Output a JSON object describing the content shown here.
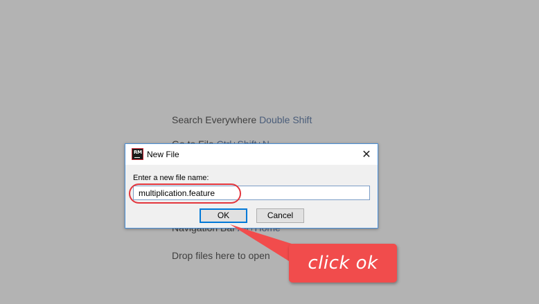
{
  "hints": {
    "search_label": "Search Everywhere",
    "search_shortcut": "Double Shift",
    "partial_label": "Go to File",
    "partial_shortcut": "Ctrl+Shift+N",
    "nav_label": "Navigation Bar",
    "nav_shortcut": "Alt+Home",
    "drop_label": "Drop files here to open"
  },
  "dialog": {
    "app_icon_text": "RM",
    "title": "New File",
    "close_glyph": "✕",
    "prompt": "Enter a new file name:",
    "file_name": "multiplication.feature",
    "ok_label": "OK",
    "cancel_label": "Cancel"
  },
  "annotation": {
    "callout_text": "click ok",
    "color": "#f14c4c"
  },
  "colors": {
    "background": "#b3b3b3",
    "dialog_border": "#4a90d9",
    "highlight": "#e3353c"
  }
}
